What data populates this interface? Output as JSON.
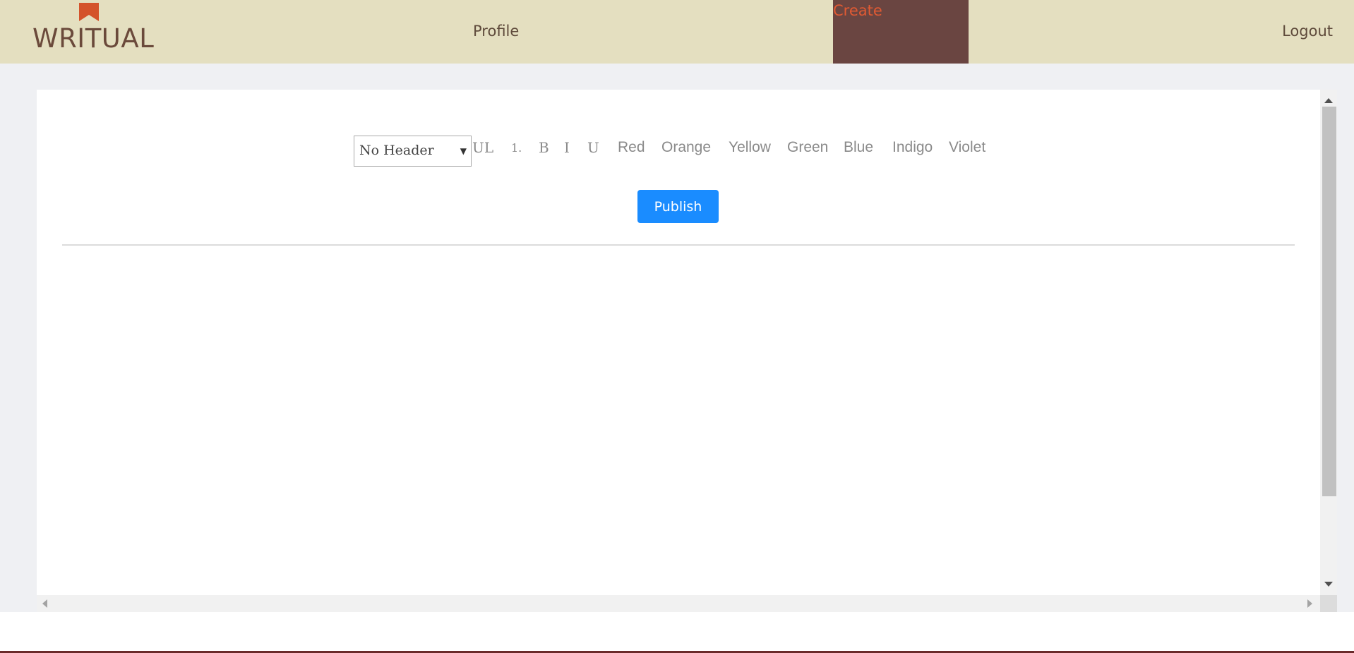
{
  "navbar": {
    "logo_text": "WRITUAL",
    "logo_icon": "bookmark-icon",
    "links": {
      "profile": "Profile",
      "create": "Create",
      "logout": "Logout"
    },
    "colors": {
      "background": "#e4dfc0",
      "active_tab_background": "#6a4541",
      "active_tab_text": "#e05a33",
      "logo_accent": "#d4532b"
    }
  },
  "toolbar": {
    "header_select": {
      "value": "No Header",
      "arrow": "▼"
    },
    "buttons": {
      "ul": "UL",
      "ol": "1.",
      "bold": "B",
      "italic": "I",
      "underline": "U",
      "red": "Red",
      "orange": "Orange",
      "yellow": "Yellow",
      "green": "Green",
      "blue": "Blue",
      "indigo": "Indigo",
      "violet": "Violet"
    }
  },
  "publish": {
    "label": "Publish",
    "color": "#1a8cff"
  },
  "editor": {
    "content": ""
  }
}
